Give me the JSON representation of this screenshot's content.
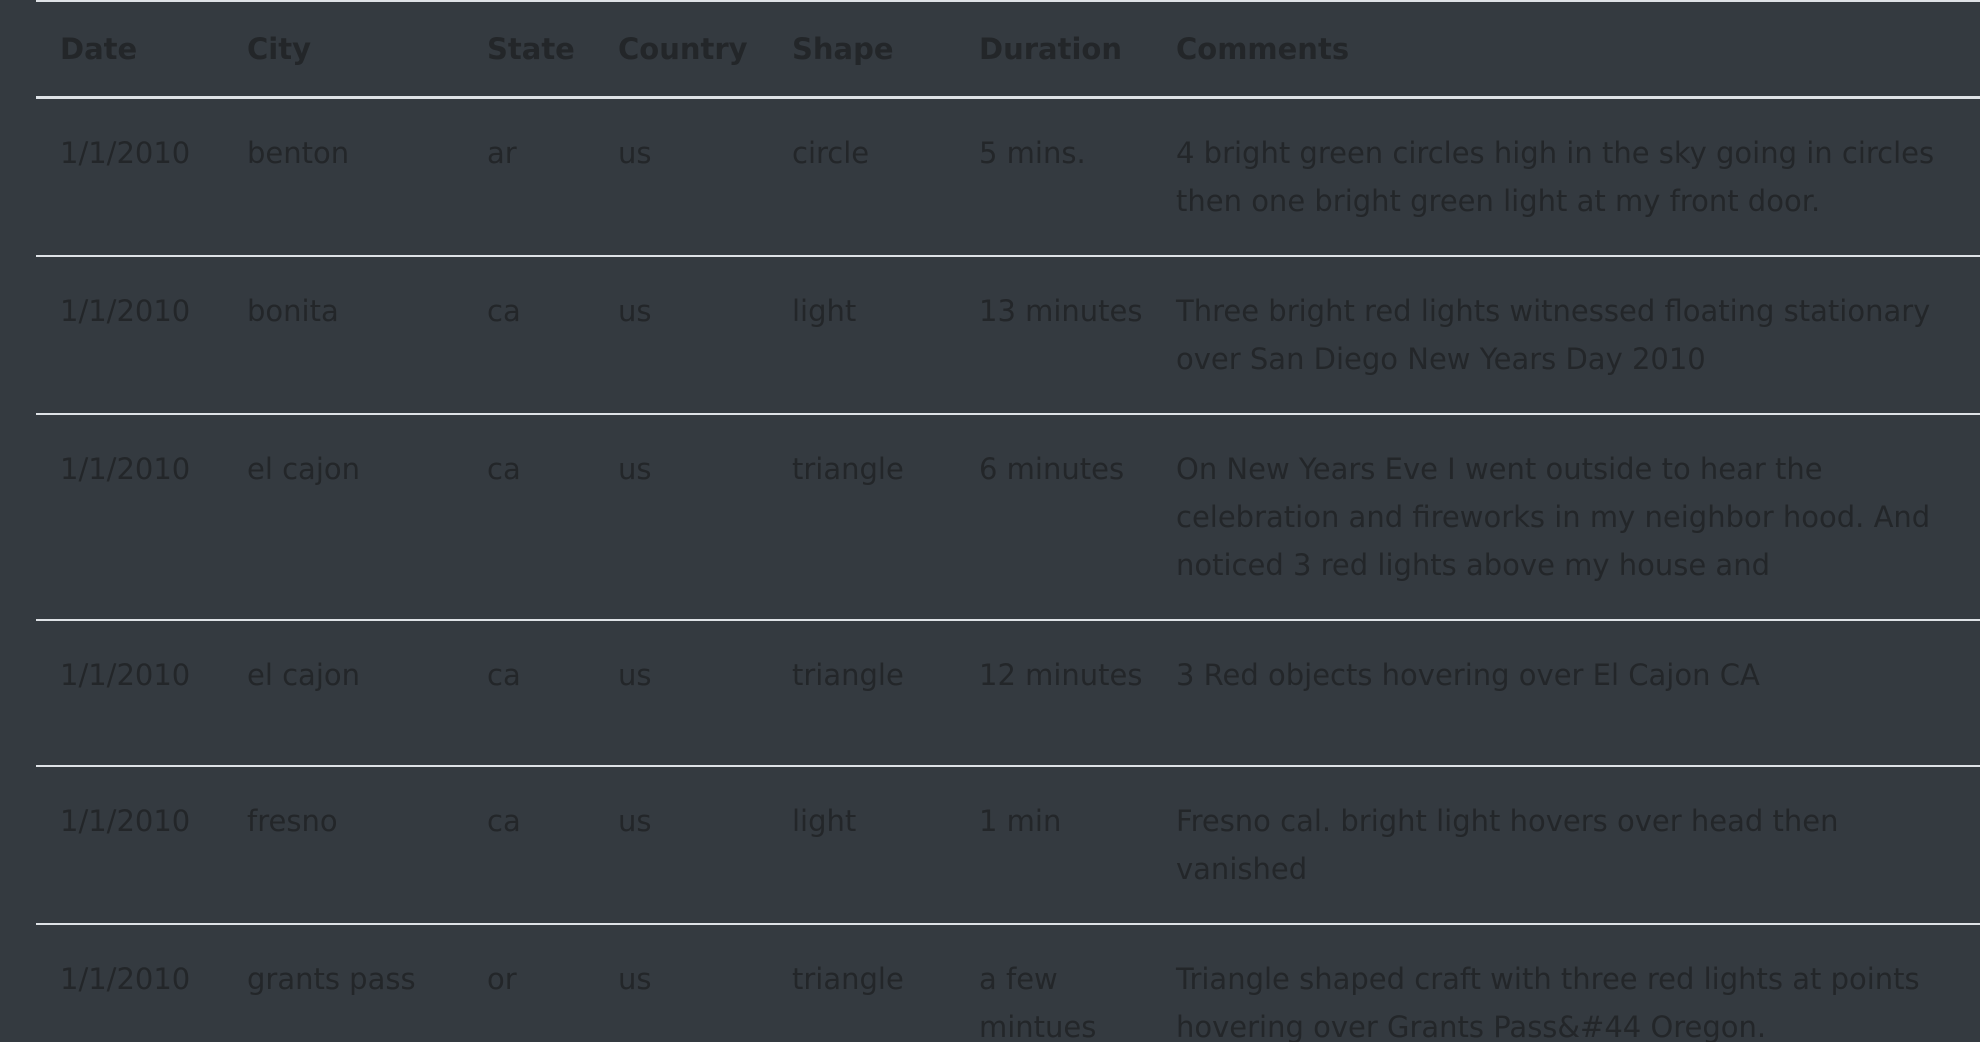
{
  "table": {
    "headers": [
      "Date",
      "City",
      "State",
      "Country",
      "Shape",
      "Duration",
      "Comments"
    ],
    "rows": [
      [
        "1/1/2010",
        "benton",
        "ar",
        "us",
        "circle",
        "5 mins.",
        "4 bright green circles high in the sky going in circles then one bright green light at my front door."
      ],
      [
        "1/1/2010",
        "bonita",
        "ca",
        "us",
        "light",
        "13 minutes",
        "Three bright red lights witnessed floating stationary over San Diego New Years Day 2010"
      ],
      [
        "1/1/2010",
        "el cajon",
        "ca",
        "us",
        "triangle",
        "6 minutes",
        "On New Years Eve I went outside to hear the celebration and fireworks in my neighbor hood. And noticed 3 red lights above my house and"
      ],
      [
        "1/1/2010",
        "el cajon",
        "ca",
        "us",
        "triangle",
        "12 minutes",
        "3 Red objects hovering over El Cajon CA"
      ],
      [
        "1/1/2010",
        "fresno",
        "ca",
        "us",
        "light",
        "1 min",
        "Fresno cal. bright light hovers over head then vanished"
      ],
      [
        "1/1/2010",
        "grants pass",
        "or",
        "us",
        "triangle",
        "a few mintues",
        "Triangle shaped craft with three red lights at points hovering over Grants Pass&#44 Oregon."
      ]
    ]
  }
}
